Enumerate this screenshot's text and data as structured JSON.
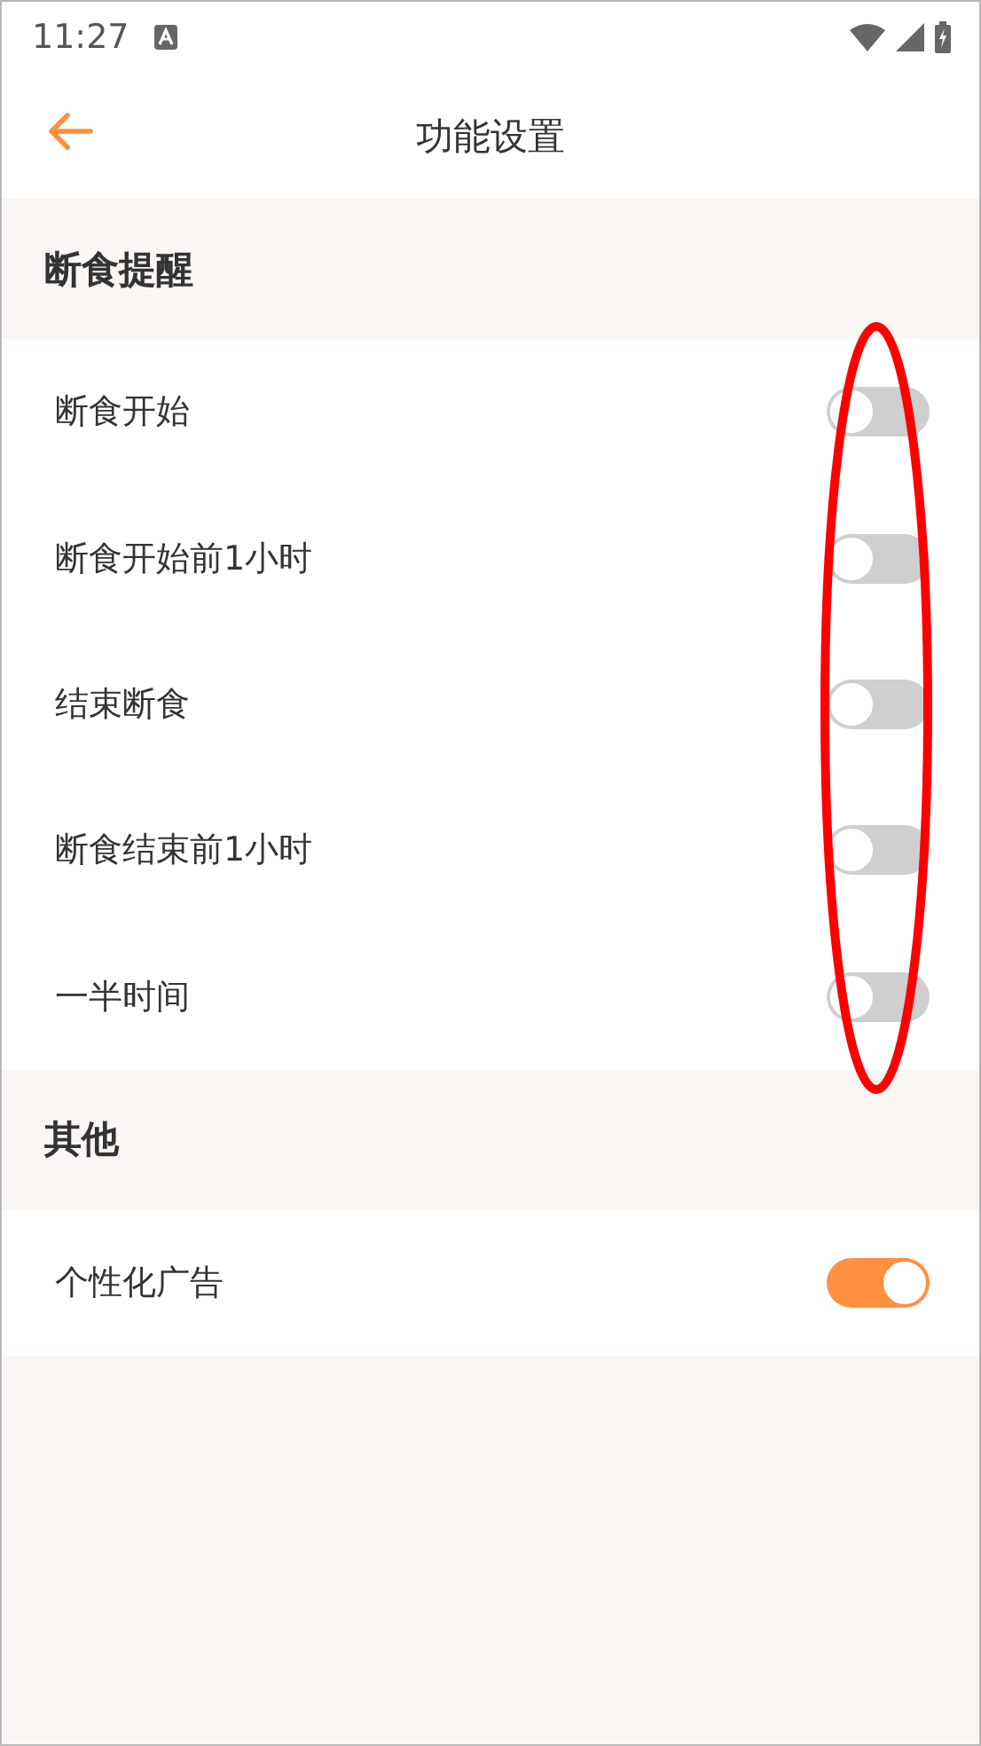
{
  "status_bar": {
    "time": "11:27"
  },
  "header": {
    "title": "功能设置"
  },
  "sections": [
    {
      "title": "断食提醒",
      "items": [
        {
          "label": "断食开始",
          "on": false
        },
        {
          "label": "断食开始前1小时",
          "on": false
        },
        {
          "label": "结束断食",
          "on": false
        },
        {
          "label": "断食结束前1小时",
          "on": false
        },
        {
          "label": "一半时间",
          "on": false
        }
      ]
    },
    {
      "title": "其他",
      "items": [
        {
          "label": "个性化广告",
          "on": true
        }
      ]
    }
  ]
}
